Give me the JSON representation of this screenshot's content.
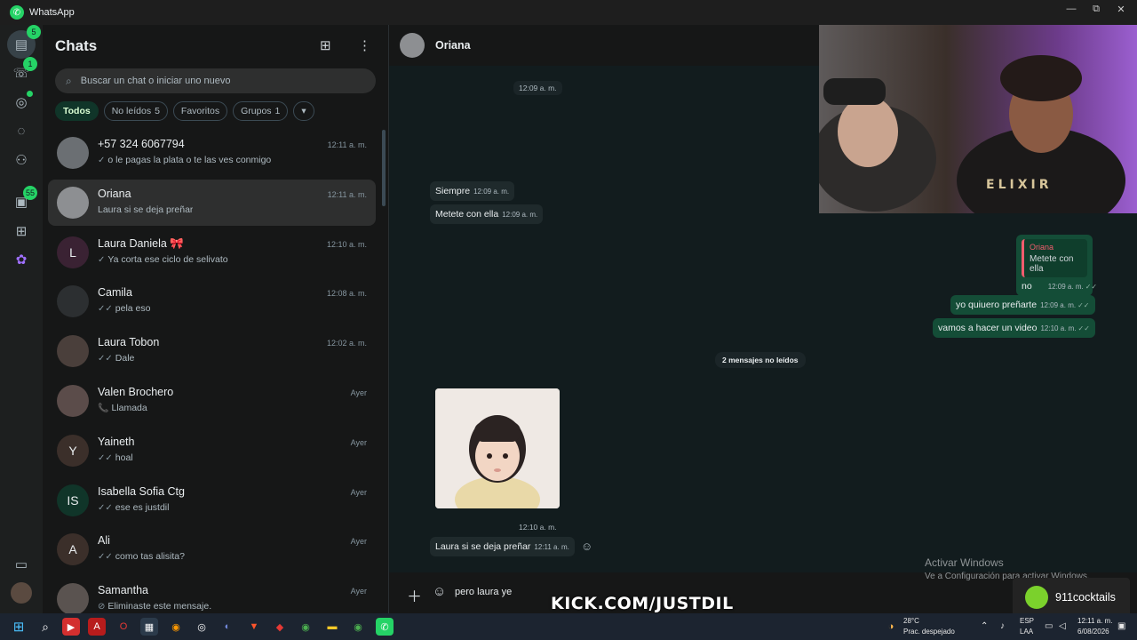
{
  "window": {
    "title": "WhatsApp"
  },
  "rail": {
    "chats_badge": "5",
    "calls_badge": "1",
    "archive_badge": "55"
  },
  "chatlist": {
    "title": "Chats",
    "search_placeholder": "Buscar un chat o iniciar uno nuevo",
    "filters": [
      {
        "label": "Todos",
        "count": ""
      },
      {
        "label": "No leídos",
        "count": "5"
      },
      {
        "label": "Favoritos",
        "count": ""
      },
      {
        "label": "Grupos",
        "count": "1"
      }
    ],
    "chats": [
      {
        "name": "+57 324 6067794",
        "time": "12:11 a. m.",
        "preview": "o le pagas la plata o te las ves conmigo",
        "tick": "✓",
        "avatar_letter": "",
        "avatar_color": "#6b6f73"
      },
      {
        "name": "Oriana",
        "time": "12:11 a. m.",
        "preview": "Laura si se deja preñar",
        "tick": "",
        "avatar_letter": "",
        "avatar_color": "#8d8f92"
      },
      {
        "name": "Laura Daniela 🎀",
        "time": "12:10 a. m.",
        "preview": "Ya corta ese ciclo de selivato",
        "tick": "✓",
        "avatar_letter": "L",
        "avatar_color": "#3a2233"
      },
      {
        "name": "Camila",
        "time": "12:08 a. m.",
        "preview": "pela eso",
        "tick": "✓✓",
        "avatar_letter": "",
        "avatar_color": "#2c2f31"
      },
      {
        "name": "Laura Tobon",
        "time": "12:02 a. m.",
        "preview": "Dale",
        "tick": "✓✓",
        "avatar_letter": "",
        "avatar_color": "#4a3f3b"
      },
      {
        "name": "Valen  Brochero",
        "time": "Ayer",
        "preview": "Llamada",
        "tick": "📞",
        "avatar_letter": "",
        "avatar_color": "#5b4c4a"
      },
      {
        "name": "Yaineth",
        "time": "Ayer",
        "preview": "hoal",
        "tick": "✓✓",
        "avatar_letter": "Y",
        "avatar_color": "#3b2f2a"
      },
      {
        "name": "Isabella Sofia Ctg",
        "time": "Ayer",
        "preview": "ese es justdil",
        "tick": "✓✓",
        "avatar_letter": "IS",
        "avatar_color": "#103529"
      },
      {
        "name": "Ali",
        "time": "Ayer",
        "preview": "como tas alisita?",
        "tick": "✓✓",
        "avatar_letter": "A",
        "avatar_color": "#3b2f2a"
      },
      {
        "name": "Samantha",
        "time": "Ayer",
        "preview": "Eliminaste este mensaje.",
        "tick": "⊘",
        "avatar_letter": "",
        "avatar_color": "#5a5350"
      }
    ]
  },
  "conversation": {
    "contact": "Oriana",
    "date_top": "12:09 a. m.",
    "messages": [
      {
        "text": "Siempre",
        "time": "12:09 a. m."
      },
      {
        "text": "Metete con ella",
        "time": "12:09 a. m."
      },
      {
        "quote_name": "Oriana",
        "quote_text": "Metete con ella",
        "text": "no",
        "time": "12:09 a. m."
      },
      {
        "text": "yo quiuero preñarte",
        "time": "12:09 a. m."
      },
      {
        "text": "vamos a hacer un video",
        "time": "12:10 a. m."
      },
      {
        "text": "Laura si se deja preñar",
        "time": "12:11 a. m."
      }
    ],
    "unread_divider": "2 mensajes no leídos",
    "photo_time": "12:10 a. m.",
    "composer_value": "pero laura ye"
  },
  "overlay": {
    "kick": "KICK.COM/JUSTDIL",
    "activate_title": "Activar Windows",
    "activate_sub": "Ve a Configuración para activar Windows.",
    "sponsor": "911cocktails",
    "webcam_shirt": "ELIXIR"
  },
  "taskbar": {
    "weather_temp": "28°C",
    "weather_desc": "Prac. despejado",
    "lang_1": "ESP",
    "lang_2": "LAA",
    "clock_time": "12:11 a. m.",
    "clock_date": "6/08/2026"
  },
  "colors": {
    "accent": "#25d366",
    "outgoing": "#144d37",
    "incoming": "#1f2a2c",
    "quote_name": "#f15c6d"
  }
}
